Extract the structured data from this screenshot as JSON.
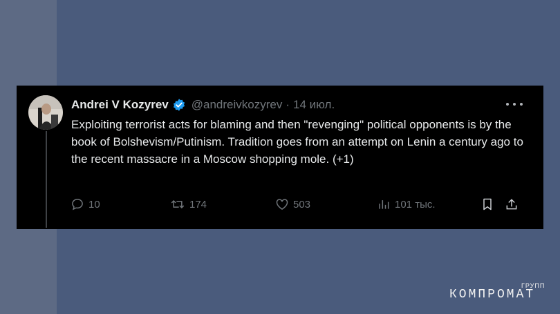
{
  "tweet": {
    "author_name": "Andrei V Kozyrev",
    "handle": "@andreivkozyrev",
    "separator": "·",
    "date": "14 июл.",
    "text": "Exploiting terrorist acts for blaming and then \"revenging\" political opponents is by the book of Bolshevism/Putinism. Tradition goes from an attempt on Lenin a century ago to the recent massacre in a Moscow shopping mole.  (+1)",
    "verified_color": "#1d9bf0"
  },
  "actions": {
    "replies": "10",
    "retweets": "174",
    "likes": "503",
    "views": "101 тыс."
  },
  "icons": {
    "reply": "reply-icon",
    "retweet": "retweet-icon",
    "like": "heart-icon",
    "views": "views-icon",
    "bookmark": "bookmark-icon",
    "share": "share-icon",
    "more": "more-icon",
    "verified": "verified-badge-icon",
    "prev": "chevron-left-icon"
  },
  "watermark": {
    "main": "КОМПРОМАТ",
    "sub": "ГРУПП"
  }
}
